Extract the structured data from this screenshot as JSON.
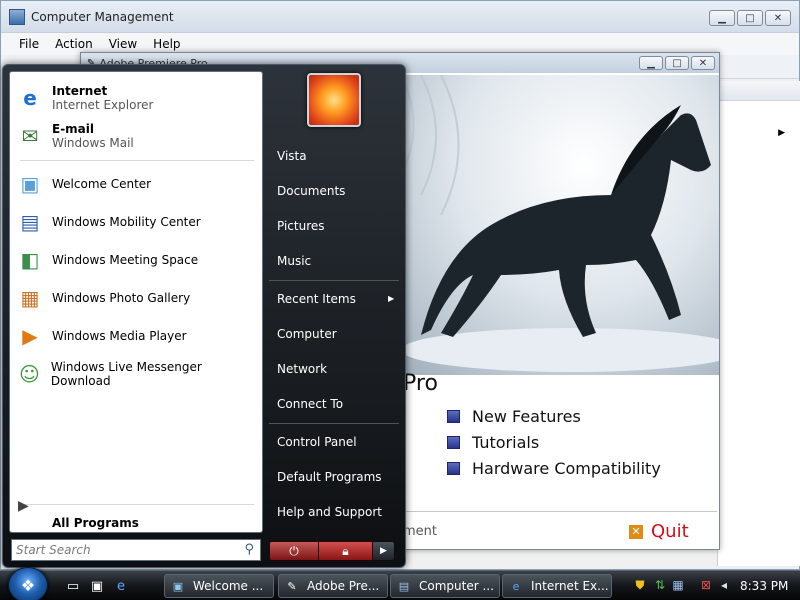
{
  "computer_management": {
    "title": "Computer Management",
    "menu": [
      "File",
      "Action",
      "View",
      "Help"
    ]
  },
  "premiere": {
    "title": "Adobe Premiere Pro",
    "splash_title": "Pro",
    "features": [
      "New Features",
      "Tutorials",
      "Hardware Compatibility"
    ],
    "footer_text": "ment",
    "quit_label": "Quit"
  },
  "start_menu": {
    "pinned": [
      {
        "title": "Internet",
        "subtitle": "Internet Explorer"
      },
      {
        "title": "E-mail",
        "subtitle": "Windows Mail"
      }
    ],
    "recent": [
      "Welcome Center",
      "Windows Mobility Center",
      "Windows Meeting Space",
      "Windows Photo Gallery",
      "Windows Media Player",
      "Windows Live Messenger Download"
    ],
    "all_programs": "All Programs",
    "search_placeholder": "Start Search",
    "right_items": {
      "user": "Vista",
      "documents": "Documents",
      "pictures": "Pictures",
      "music": "Music",
      "recent_items": "Recent Items",
      "computer": "Computer",
      "network": "Network",
      "connect_to": "Connect To",
      "control_panel": "Control Panel",
      "default_programs": "Default Programs",
      "help_support": "Help and Support"
    }
  },
  "taskbar": {
    "buttons": [
      "Welcome ...",
      "Adobe Pre...",
      "Computer ...",
      "Internet Ex..."
    ],
    "clock": "8:33 PM"
  },
  "icons": {
    "internet": "internet-explorer-icon",
    "email": "windows-mail-icon",
    "search": "search-icon",
    "power": "power-icon",
    "lock": "lock-icon"
  }
}
